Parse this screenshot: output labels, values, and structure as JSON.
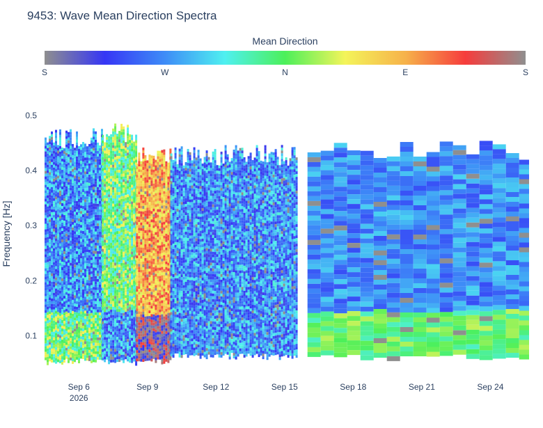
{
  "chart_data": {
    "type": "heatmap",
    "title": "9453: Wave Mean Direction Spectra",
    "ylabel": "Frequency [Hz]",
    "xlabel": "",
    "ylim": [
      0.04,
      0.52
    ],
    "y_ticks": [
      0.1,
      0.2,
      0.3,
      0.4,
      0.5
    ],
    "y_tick_labels": [
      "0.1",
      "0.2",
      "0.3",
      "0.4",
      "0.5"
    ],
    "x_range_days": [
      "2026-09-04T12:00",
      "2026-09-25T13:00"
    ],
    "x_ticks": [
      {
        "date": "2026-09-06",
        "label": "Sep 6",
        "sublabel": "2026"
      },
      {
        "date": "2026-09-09",
        "label": "Sep 9",
        "sublabel": ""
      },
      {
        "date": "2026-09-12",
        "label": "Sep 12",
        "sublabel": ""
      },
      {
        "date": "2026-09-15",
        "label": "Sep 15",
        "sublabel": ""
      },
      {
        "date": "2026-09-18",
        "label": "Sep 18",
        "sublabel": ""
      },
      {
        "date": "2026-09-21",
        "label": "Sep 21",
        "sublabel": ""
      },
      {
        "date": "2026-09-24",
        "label": "Sep 24",
        "sublabel": ""
      }
    ],
    "colorbar": {
      "title": "Mean Direction",
      "orientation": "horizontal",
      "placement": "top",
      "tick_labels": [
        "S",
        "W",
        "N",
        "E",
        "S"
      ],
      "colorscale": [
        "#8f8f8f",
        "#3636f5",
        "#3e8cf7",
        "#4ff0f0",
        "#4cf05a",
        "#f4f45a",
        "#f6b24a",
        "#f63c3c",
        "#8f8f8f"
      ]
    },
    "regions": [
      {
        "start": "2026-09-04T12:00",
        "end": "2026-09-07T00:00",
        "fmin": 0.06,
        "fmax": 0.45,
        "dominant": "W",
        "low_freq": "N"
      },
      {
        "start": "2026-09-07T00:00",
        "end": "2026-09-08T12:00",
        "fmin": 0.06,
        "fmax": 0.46,
        "dominant": "N",
        "low_freq": "W"
      },
      {
        "start": "2026-09-08T12:00",
        "end": "2026-09-10T00:00",
        "fmin": 0.06,
        "fmax": 0.42,
        "dominant": "E",
        "low_freq": "S"
      },
      {
        "start": "2026-09-10T00:00",
        "end": "2026-09-15T12:00",
        "fmin": 0.07,
        "fmax": 0.42,
        "dominant": "W",
        "low_freq": "W"
      },
      {
        "start": "2026-09-16T00:00",
        "end": "2026-09-25T13:00",
        "fmin": 0.07,
        "fmax": 0.43,
        "dominant": "W",
        "low_freq": "N"
      }
    ]
  }
}
